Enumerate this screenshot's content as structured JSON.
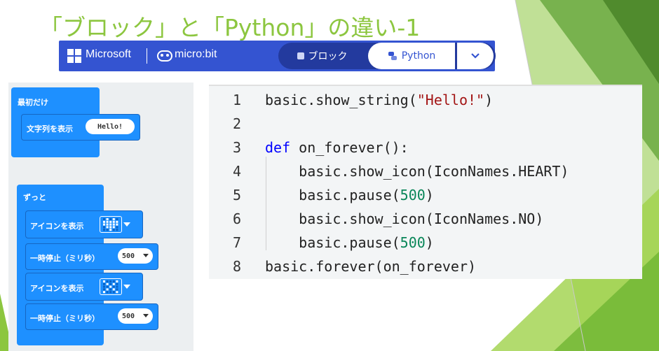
{
  "slide_title": "「ブロック」と「Python」の違い-1",
  "topbar": {
    "microsoft_label": "Microsoft",
    "microbit_label": "micro:bit",
    "tab_blocks_label": "ブロック",
    "tab_python_label": "Python",
    "dropdown_icon": "chevron-down-icon"
  },
  "blocks": {
    "on_start_label": "最初だけ",
    "show_string_label": "文字列を表示",
    "show_string_value": "Hello!",
    "forever_label": "ずっと",
    "show_icon_label_1": "アイコンを表示",
    "pause_label_1": "一時停止（ミリ秒）",
    "pause_value_1": "500",
    "show_icon_label_2": "アイコンを表示",
    "pause_label_2": "一時停止（ミリ秒）",
    "pause_value_2": "500"
  },
  "code": {
    "lines": [
      {
        "n": "1",
        "pre": "basic.show_string(",
        "str": "\"Hello!\"",
        "post": ")"
      },
      {
        "n": "2",
        "pre": "",
        "str": "",
        "post": ""
      },
      {
        "n": "3",
        "kw": "def",
        "pre": " on_forever():",
        "str": "",
        "post": ""
      },
      {
        "n": "4",
        "pre": "    basic.show_icon(IconNames.HEART)",
        "str": "",
        "post": ""
      },
      {
        "n": "5",
        "pre": "    basic.pause(",
        "num": "500",
        "post": ")"
      },
      {
        "n": "6",
        "pre": "    basic.show_icon(IconNames.NO)",
        "str": "",
        "post": ""
      },
      {
        "n": "7",
        "pre": "    basic.pause(",
        "num": "500",
        "post": ")"
      },
      {
        "n": "8",
        "pre": "basic.forever(on_forever)",
        "str": "",
        "post": ""
      }
    ]
  },
  "colors": {
    "title": "#8cc63f",
    "topbar": "#3454d1",
    "block": "#1e90ff",
    "keyword": "#0000ff",
    "string": "#a31515",
    "number": "#098658"
  }
}
